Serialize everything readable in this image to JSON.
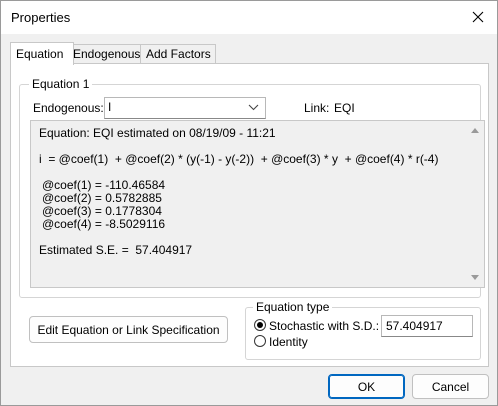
{
  "window": {
    "title": "Properties"
  },
  "tabs": [
    {
      "label": "Equation"
    },
    {
      "label": "Endogenous"
    },
    {
      "label": "Add Factors"
    }
  ],
  "equation_group": {
    "legend": "Equation 1",
    "endogenous_label": "Endogenous:",
    "endogenous_value": "I",
    "link_label": "Link:",
    "link_value": "EQI"
  },
  "equation_text": {
    "header": "Equation: EQI estimated on 08/19/09 - 11:21",
    "formula": "i  = @coef(1)  + @coef(2) * (y(-1) - y(-2))  + @coef(3) * y  + @coef(4) * r(-4)",
    "coefficients": [
      "@coef(1) = -110.46584",
      "@coef(2) = 0.5782885",
      "@coef(3) = 0.1778304",
      "@coef(4) = -8.5029116"
    ],
    "se": "Estimated S.E. =  57.404917"
  },
  "buttons": {
    "edit_equation": "Edit Equation or Link Specification",
    "ok": "OK",
    "cancel": "Cancel"
  },
  "equation_type": {
    "legend": "Equation type",
    "stochastic_label": "Stochastic with S.D.:",
    "stochastic_checked": true,
    "sd_value": "57.404917",
    "identity_label": "Identity",
    "identity_checked": false
  },
  "icons": {
    "close": "close-icon",
    "combo_arrow": "chevron-down-icon",
    "scroll_up": "scroll-up-arrow-icon",
    "scroll_down": "scroll-down-arrow-icon"
  }
}
